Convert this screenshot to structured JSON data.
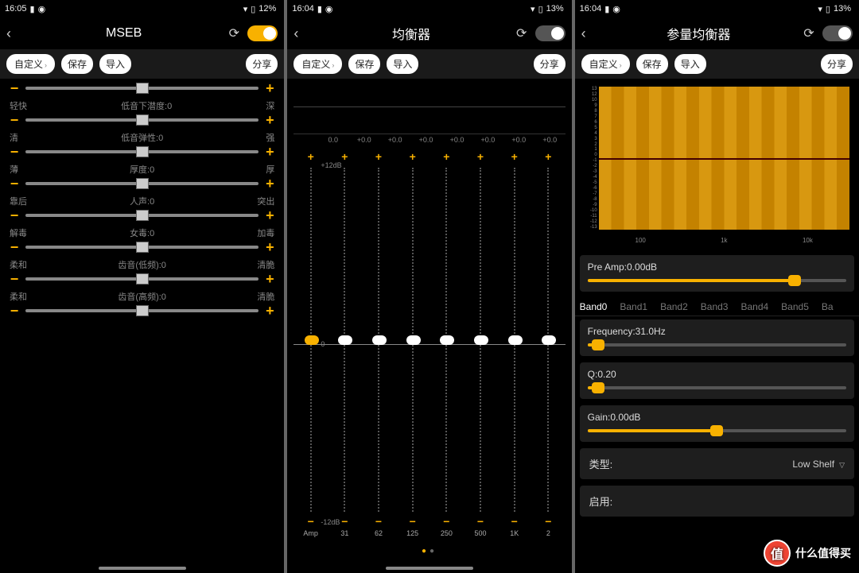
{
  "status": {
    "time1": "16:05",
    "time2": "16:04",
    "time3": "16:04",
    "batt1": "12%",
    "batt2": "13%",
    "batt3": "13%"
  },
  "common": {
    "pills": {
      "custom": "自定义",
      "save": "保存",
      "import": "导入",
      "share": "分享"
    }
  },
  "screen1": {
    "title": "MSEB",
    "rows": [
      {
        "l": "",
        "c": "",
        "r": ""
      },
      {
        "l": "轻快",
        "c": "低音下潜度:0",
        "r": "深"
      },
      {
        "l": "清",
        "c": "低音弹性:0",
        "r": "强"
      },
      {
        "l": "薄",
        "c": "厚度:0",
        "r": "厚"
      },
      {
        "l": "靠后",
        "c": "人声:0",
        "r": "突出"
      },
      {
        "l": "解毒",
        "c": "女毒:0",
        "r": "加毒"
      },
      {
        "l": "柔和",
        "c": "齿音(低频):0",
        "r": "清脆"
      },
      {
        "l": "柔和",
        "c": "齿音(高频):0",
        "r": "清脆"
      }
    ]
  },
  "screen2": {
    "title": "均衡器",
    "topDb": "+12dB",
    "midDb": "0",
    "botDb": "-12dB",
    "values": [
      "0.0",
      "+0.0",
      "+0.0",
      "+0.0",
      "+0.0",
      "+0.0",
      "+0.0",
      "+0.0"
    ],
    "bands": [
      "Amp",
      "31",
      "62",
      "125",
      "250",
      "500",
      "1K",
      "2"
    ]
  },
  "screen3": {
    "title": "参量均衡器",
    "yticks": [
      "13",
      "12",
      "10",
      "9",
      "8",
      "7",
      "6",
      "5",
      "4",
      "3",
      "2",
      "1",
      "0",
      "-1",
      "-2",
      "-3",
      "-4",
      "-5",
      "-6",
      "-7",
      "-8",
      "-9",
      "-10",
      "-11",
      "-12",
      "-13"
    ],
    "xticks": [
      "100",
      "1k",
      "10k"
    ],
    "preamp": {
      "label": "Pre Amp:0.00dB",
      "pct": 80
    },
    "tabs": [
      "Band0",
      "Band1",
      "Band2",
      "Band3",
      "Band4",
      "Band5",
      "Ba"
    ],
    "freq": {
      "label": "Frequency:31.0Hz",
      "pct": 4
    },
    "q": {
      "label": "Q:0.20",
      "pct": 4
    },
    "gain": {
      "label": "Gain:0.00dB",
      "pct": 50
    },
    "typeLabel": "类型:",
    "typeValue": "Low Shelf",
    "enableLabel": "启用:"
  },
  "watermark": {
    "text": "什么值得买",
    "badge": "值"
  }
}
